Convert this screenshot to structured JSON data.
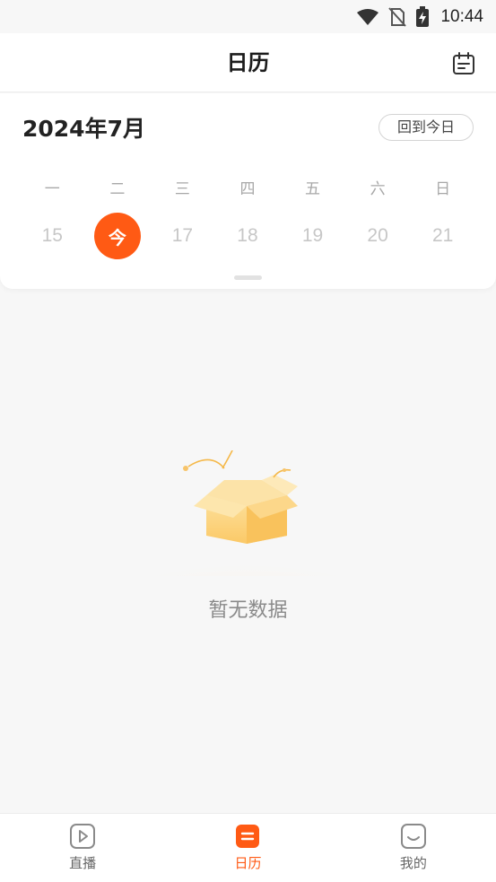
{
  "status_bar": {
    "time": "10:44"
  },
  "header": {
    "title": "日历"
  },
  "calendar": {
    "month_label": "2024年7月",
    "today_button": "回到今日",
    "weekdays": [
      "一",
      "二",
      "三",
      "四",
      "五",
      "六",
      "日"
    ],
    "dates": [
      "15",
      "今",
      "17",
      "18",
      "19",
      "20",
      "21"
    ],
    "accent_color": "#ff5a14"
  },
  "empty_state": {
    "text": "暂无数据"
  },
  "tabbar": {
    "tabs": [
      {
        "label": "直播",
        "icon": "play-icon"
      },
      {
        "label": "日历",
        "icon": "calendar-icon",
        "active": true
      },
      {
        "label": "我的",
        "icon": "smiley-icon"
      }
    ]
  }
}
